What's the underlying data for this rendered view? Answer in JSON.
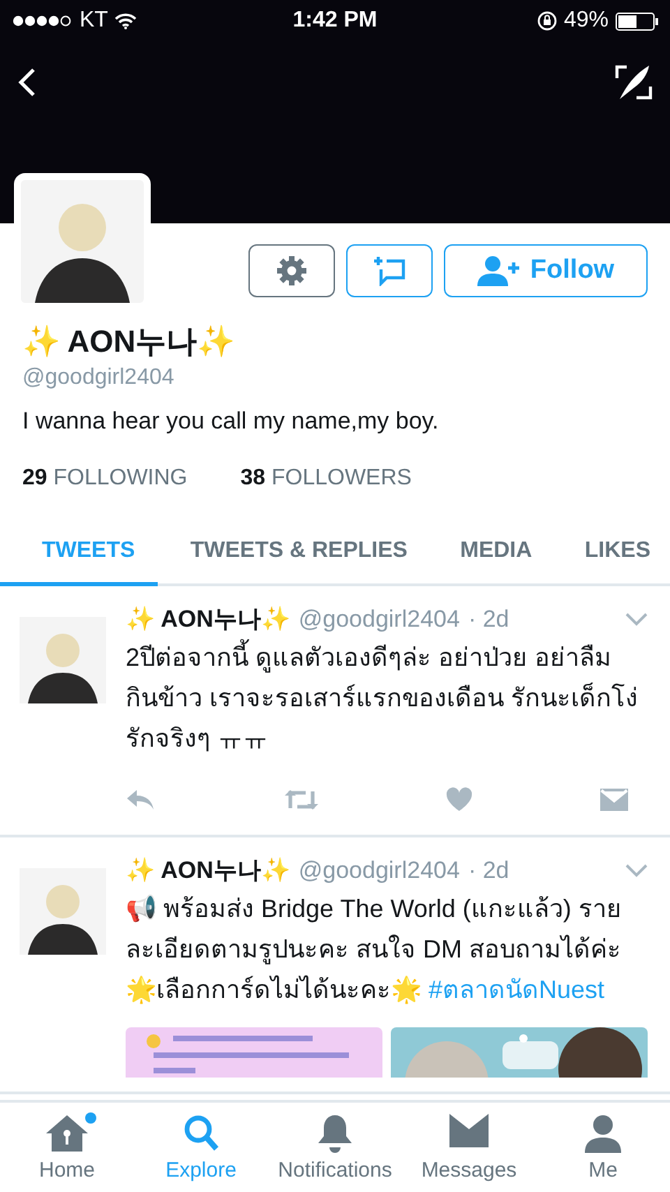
{
  "status_bar": {
    "carrier": "KT",
    "time": "1:42 PM",
    "battery": "49%"
  },
  "profile": {
    "name": "✨ AON누나✨",
    "handle": "@goodgirl2404",
    "bio": "I wanna hear you call my name,my boy.",
    "following_count": "29",
    "following_label": "FOLLOWING",
    "followers_count": "38",
    "followers_label": "FOLLOWERS",
    "follow_button": "Follow"
  },
  "tabs": [
    {
      "label": "TWEETS",
      "selected": true
    },
    {
      "label": "TWEETS & REPLIES",
      "selected": false
    },
    {
      "label": "MEDIA",
      "selected": false
    },
    {
      "label": "LIKES",
      "selected": false
    }
  ],
  "tweets": [
    {
      "name": "✨ AON누나✨",
      "handle": "@goodgirl2404",
      "time": "· 2d",
      "text": "2ปีต่อจากนี้ ดูแลตัวเองดีๆล่ะ อย่าป่วย อย่าลืม กินข้าว เราจะรอเสาร์แรกของเดือน รักนะเด็กโง่ รักจริงๆ ㅠㅠ"
    },
    {
      "name": "✨ AON누나✨",
      "handle": "@goodgirl2404",
      "time": "· 2d",
      "text": "📢 พร้อมส่ง Bridge The World (แกะแล้ว) รายละเอียดตามรูปนะคะ สนใจ DM สอบถามได้ค่ะ 🌟เลือกการ์ดไม่ได้นะคะ🌟",
      "hashtag": "#ตลาดนัดNuest"
    }
  ],
  "nav": [
    {
      "label": "Home",
      "selected": false,
      "unread": true
    },
    {
      "label": "Explore",
      "selected": true,
      "unread": false
    },
    {
      "label": "Notifications",
      "selected": false,
      "unread": false
    },
    {
      "label": "Messages",
      "selected": false,
      "unread": false
    },
    {
      "label": "Me",
      "selected": false,
      "unread": false
    }
  ]
}
